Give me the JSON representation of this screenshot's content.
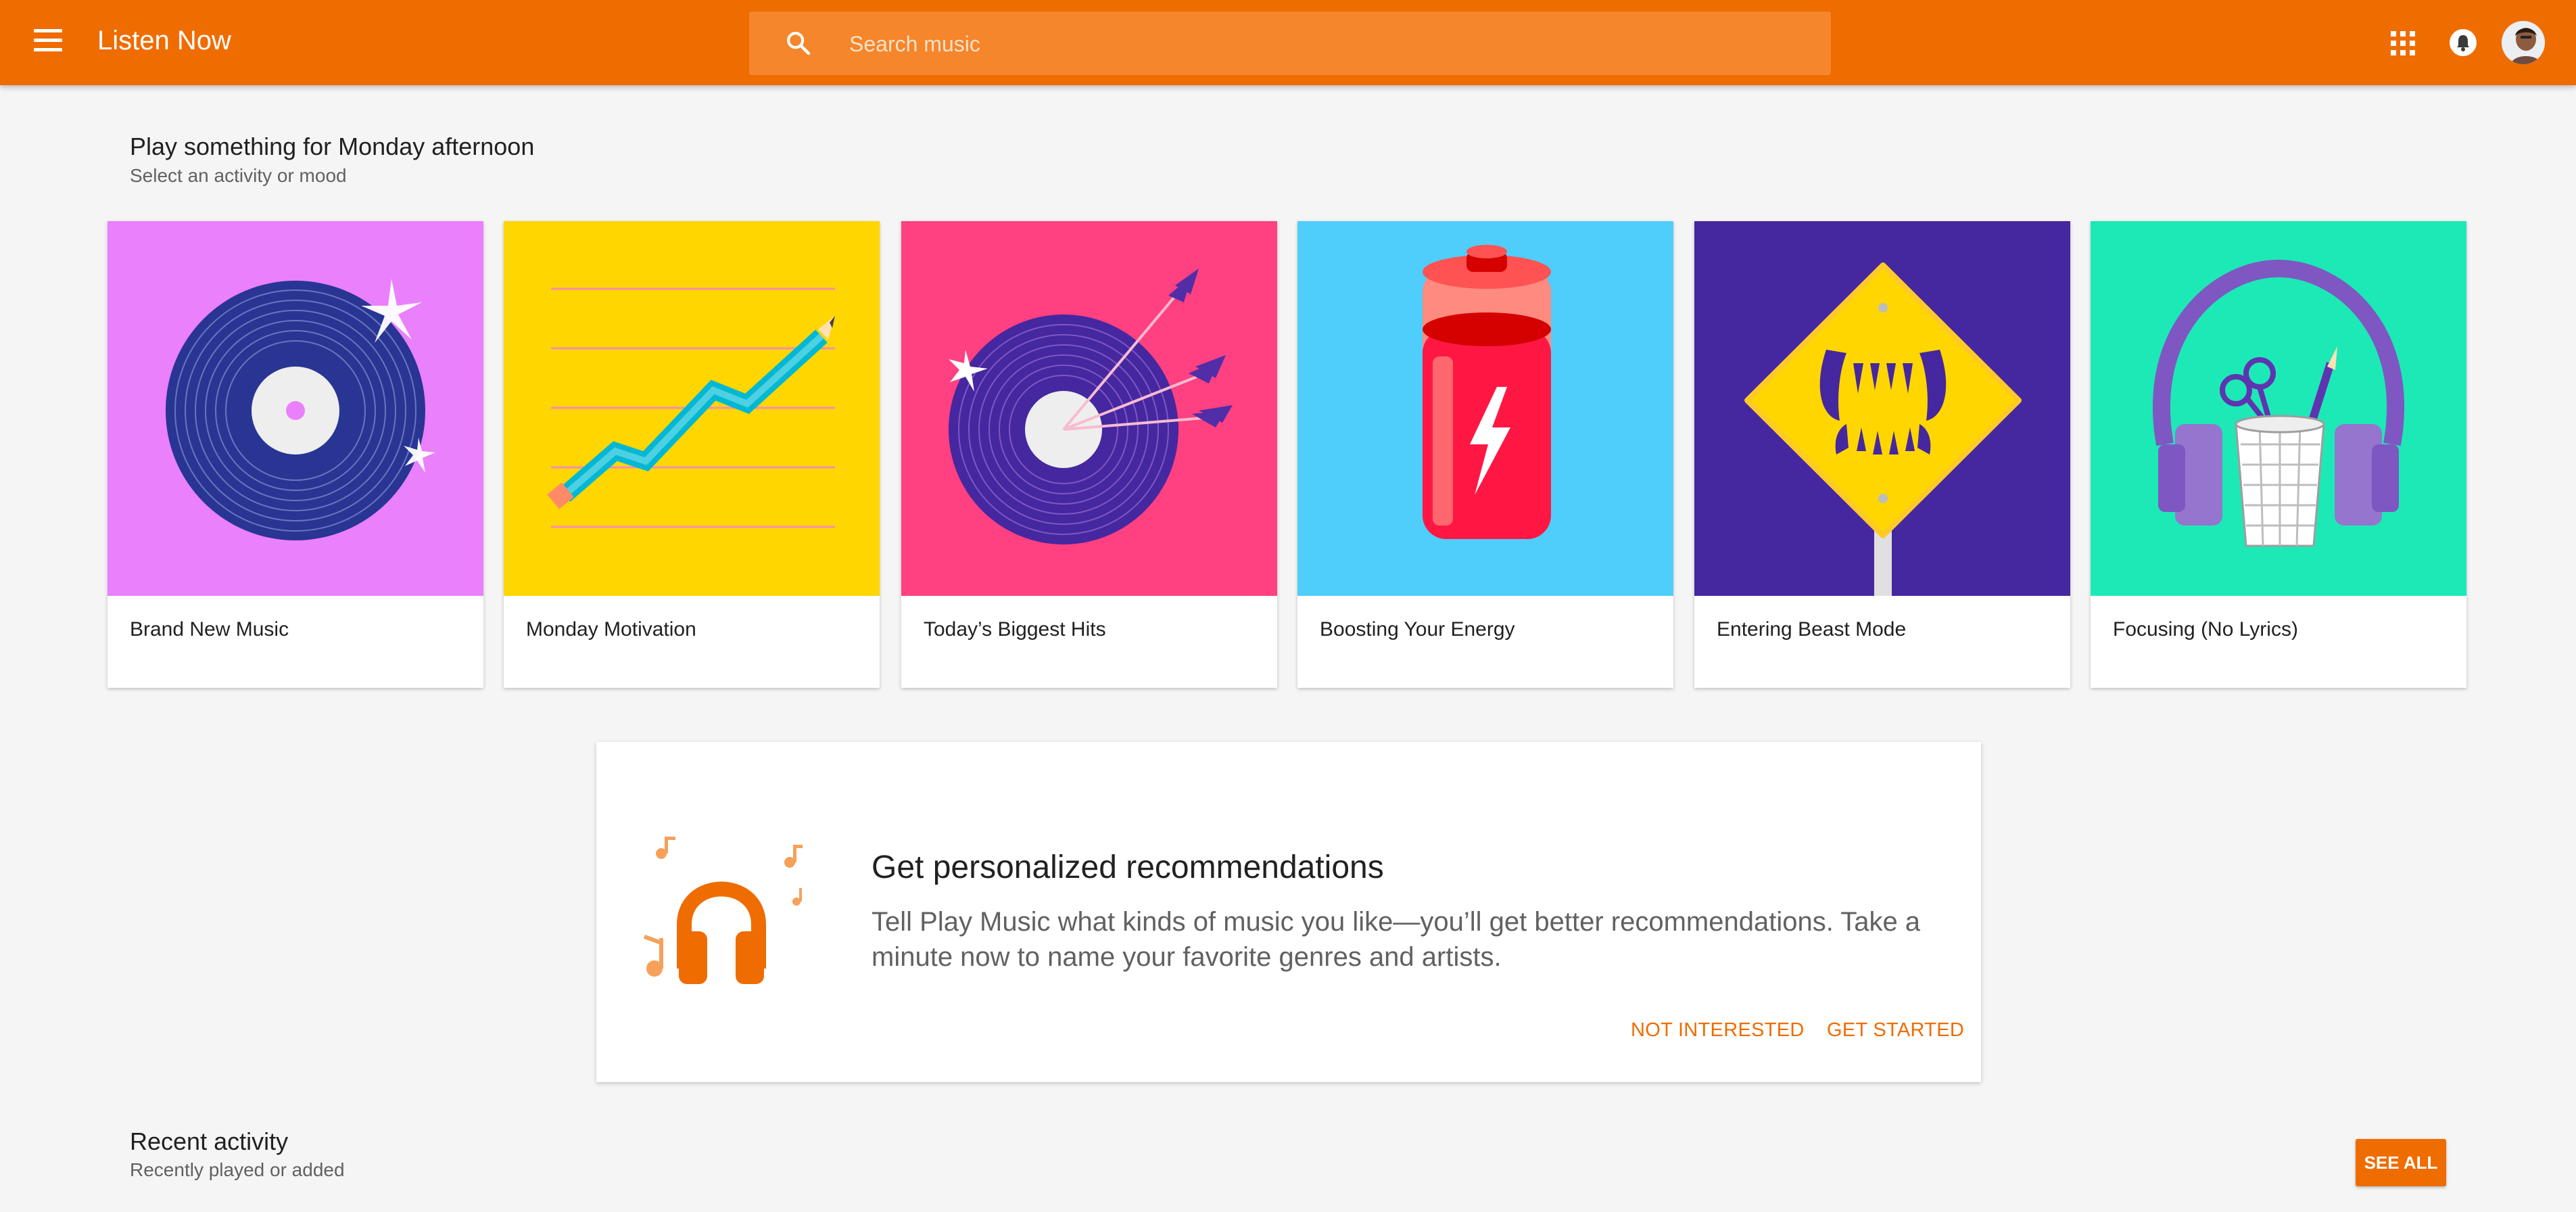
{
  "topbar": {
    "title": "Listen Now",
    "search_placeholder": "Search music",
    "icons": [
      "menu-icon",
      "search-icon",
      "apps-grid-icon",
      "notification-bell-icon",
      "user-avatar"
    ],
    "background_color": "#ef6c00"
  },
  "section": {
    "title": "Play something for Monday afternoon",
    "subtitle": "Select an activity or mood"
  },
  "cards": [
    {
      "label": "Brand New Music",
      "art_color": "#ea80fc",
      "icon": "vinyl-record-icon"
    },
    {
      "label": "Monday Motivation",
      "art_color": "#ffd600",
      "icon": "rising-pencil-chart-icon"
    },
    {
      "label": "Today’s Biggest Hits",
      "art_color": "#ff4081",
      "icon": "record-target-arrows-icon"
    },
    {
      "label": "Boosting Your Energy",
      "art_color": "#40c4ff",
      "icon": "battery-icon"
    },
    {
      "label": "Entering Beast Mode",
      "art_color": "#4527a0",
      "icon": "fangs-warning-sign-icon"
    },
    {
      "label": "Focusing (No Lyrics)",
      "art_color": "#1de9b6",
      "icon": "headphones-pencil-cup-icon"
    }
  ],
  "recommendations": {
    "title": "Get personalized recommendations",
    "body": "Tell Play Music what kinds of music you like—you’ll get better recommendations. Take a minute now to name your favorite genres and artists.",
    "not_interested_label": "NOT INTERESTED",
    "get_started_label": "GET STARTED",
    "accent_color": "#ef6c00"
  },
  "recent": {
    "title": "Recent activity",
    "subtitle": "Recently played or added",
    "see_all_label": "SEE ALL"
  }
}
